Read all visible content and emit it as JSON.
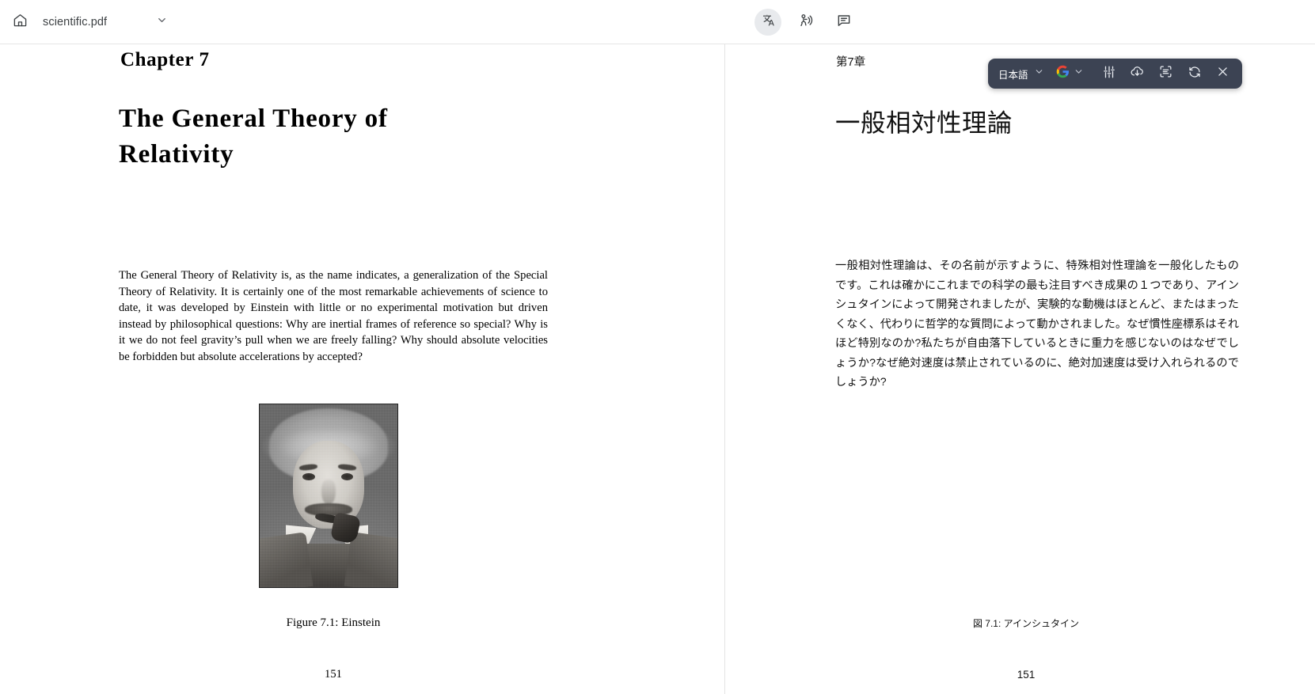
{
  "appbar": {
    "home_icon": "home-icon",
    "document_title": "scientific.pdf",
    "title_chevron_icon": "chevron-down-icon",
    "actions": [
      {
        "name": "translate-button",
        "icon": "translate-icon",
        "active": true
      },
      {
        "name": "read-aloud-button",
        "icon": "read-aloud-icon",
        "active": false
      },
      {
        "name": "comment-button",
        "icon": "comment-icon",
        "active": false
      }
    ]
  },
  "translate_toolbar": {
    "language": "日本語",
    "language_chevron_icon": "chevron-down-icon",
    "provider_icon": "google-logo-icon",
    "provider_chevron_icon": "chevron-down-icon",
    "buttons": [
      {
        "name": "settings-sliders-button",
        "icon": "sliders-icon"
      },
      {
        "name": "download-button",
        "icon": "cloud-download-icon"
      },
      {
        "name": "layout-scan-button",
        "icon": "scan-text-icon"
      },
      {
        "name": "refresh-button",
        "icon": "refresh-icon"
      },
      {
        "name": "close-button",
        "icon": "close-icon"
      }
    ],
    "background_color": "#3c4353"
  },
  "original_page": {
    "chapter_label": "Chapter 7",
    "chapter_title": "The General Theory of Relativity",
    "body": "The General Theory of Relativity is, as the name indicates, a generalization of the Special Theory of Relativity. It is certainly one of the most remarkable achievements of science to date, it was developed by Einstein with little or no experimental motivation but driven instead by philosophical questions: Why are inertial frames of reference so special?  Why is it we do not feel gravity’s pull when we are freely falling? Why should absolute velocities be forbidden but absolute accelerations by accepted?",
    "figure_caption": "Figure 7.1:  Einstein",
    "figure_alt": "einstein-portrait-photo",
    "page_number": "151"
  },
  "translated_page": {
    "chapter_label": "第7章",
    "chapter_title": "一般相対性理論",
    "body": "一般相対性理論は、その名前が示すように、特殊相対性理論を一般化したものです。これは確かにこれまでの科学の最も注目すべき成果の１つであり、アインシュタインによって開発されましたが、実験的な動機はほとんど、またはまったくなく、代わりに哲学的な質問によって動かされました。なぜ慣性座標系はそれほど特別なのか?私たちが自由落下しているときに重力を感じないのはなぜでしょうか?なぜ絶対速度は禁止されているのに、絶対加速度は受け入れられるのでしょうか?",
    "figure_caption": "図 7.1: アインシュタイン",
    "figure_alt": "einstein-portrait-photo",
    "page_number": "151"
  }
}
